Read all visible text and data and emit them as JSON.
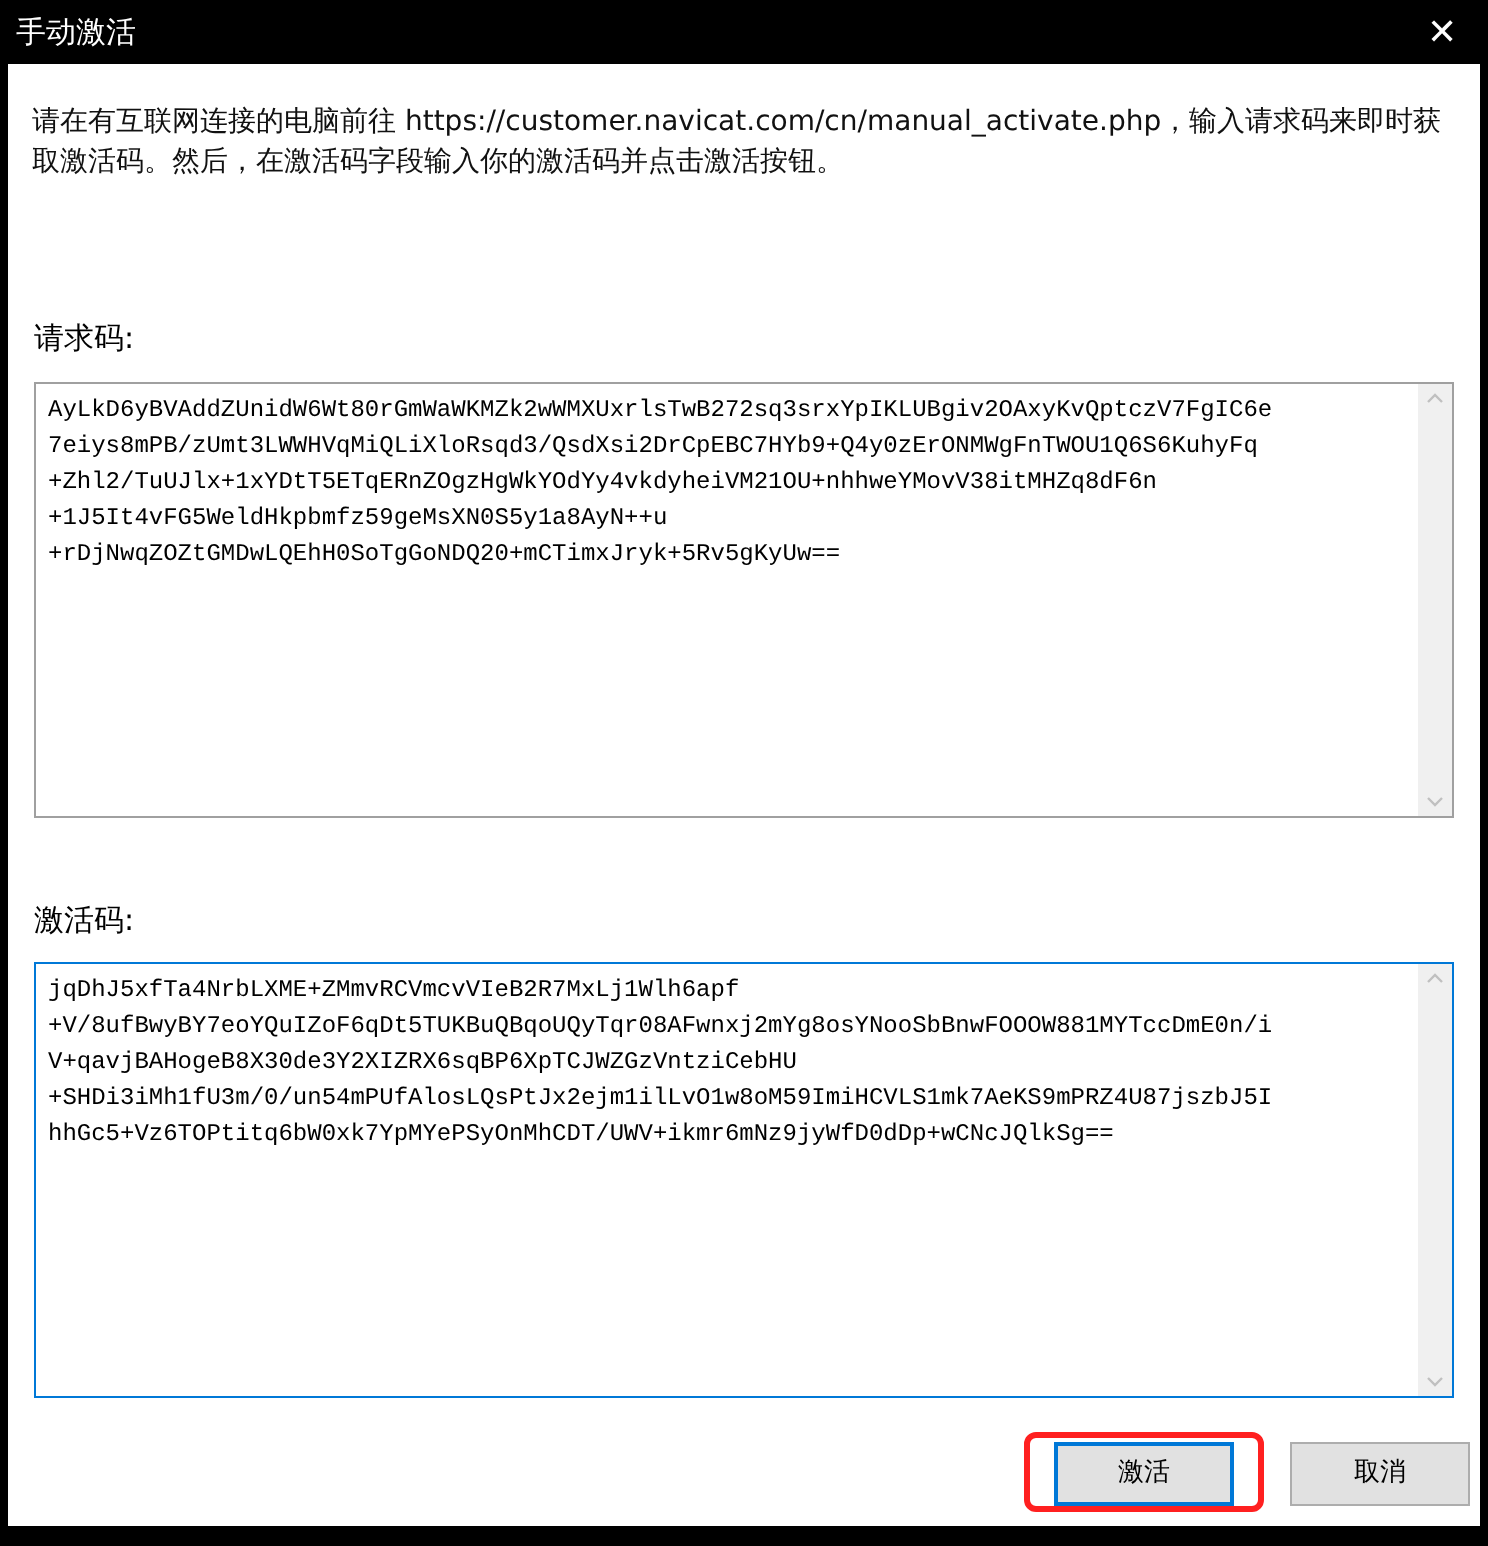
{
  "window": {
    "title": "手动激活",
    "close": "✕"
  },
  "intro": "请在有互联网连接的电脑前往 https://customer.navicat.com/cn/manual_activate.php，输入请求码来即时获取激活码。然后，在激活码字段输入你的激活码并点击激活按钮。",
  "fields": [
    {
      "label": "请求码:",
      "focused": false,
      "lines": [
        "AyLkD6yBVAddZUnidW6Wt80rGmWaWKMZk2wWMXUxrlsTwB272sq3srxYpIKLUBgiv2OAxyKvQptczV7FgIC6e",
        "7eiys8mPB/zUmt3LWWHVqMiQLiXloRsqd3/QsdXsi2DrCpEBC7HYb9+Q4y0zErONMWgFnTWOU1Q6S6KuhyFq",
        "+Zhl2/TuUJlx+1xYDtT5ETqERnZOgzHgWkYOdYy4vkdyheiVM21OU+nhhweYMovV38itMHZq8dF6n",
        "+1J5It4vFG5WeldHkpbmfz59geMsXN0S5y1a8AyN++u",
        "+rDjNwqZOZtGMDwLQEhH0SoTgGoNDQ20+mCTimxJryk+5Rv5gKyUw=="
      ]
    },
    {
      "label": "激活码:",
      "focused": true,
      "lines": [
        "jqDhJ5xfTa4NrbLXME+ZMmvRCVmcvVIeB2R7MxLj1Wlh6apf",
        "+V/8ufBwyBY7eoYQuIZoF6qDt5TUKBuQBqoUQyTqr08AFwnxj2mYg8osYNooSbBnwFOOOW881MYTccDmE0n/i",
        "V+qavjBAHogeB8X30de3Y2XIZRX6sqBP6XpTCJWZGzVntziCebHU",
        "+SHDi3iMh1fU3m/0/un54mPUfAlosLQsPtJx2ejm1ilLvO1w8oM59ImiHCVLS1mk7AeKS9mPRZ4U87jszbJ5I",
        "hhGc5+Vz6TOPtitq6bW0xk7YpMYePSyOnMhCDT/UWV+ikmr6mNz9jyWfD0dDp+wCNcJQlkSg=="
      ]
    }
  ],
  "buttons": [
    {
      "label": "激活",
      "highlighted": true,
      "kind": "primary"
    },
    {
      "label": "取消",
      "highlighted": false,
      "kind": "normal"
    }
  ]
}
